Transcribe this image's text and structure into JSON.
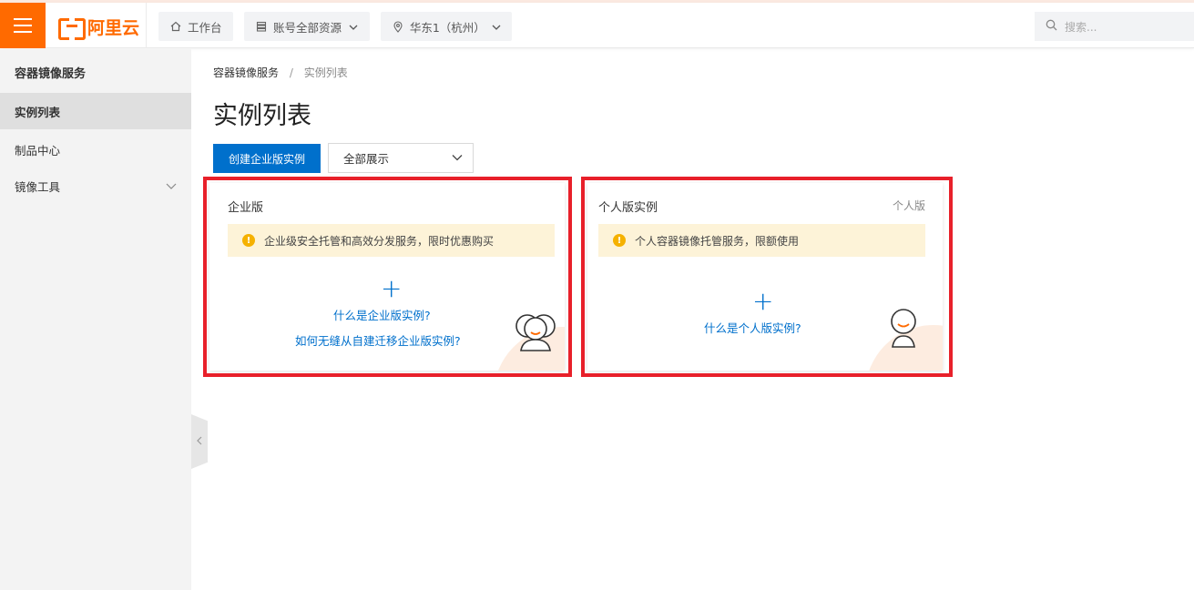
{
  "brand": {
    "name": "阿里云"
  },
  "topbar": {
    "workbench": "工作台",
    "resources": "账号全部资源",
    "region": "华东1（杭州）",
    "search_placeholder": "搜索..."
  },
  "sidebar": {
    "title": "容器镜像服务",
    "items": [
      {
        "label": "实例列表",
        "active": true
      },
      {
        "label": "制品中心"
      },
      {
        "label": "镜像工具"
      }
    ]
  },
  "breadcrumb": {
    "root": "容器镜像服务",
    "separator": "/",
    "current": "实例列表"
  },
  "page": {
    "title": "实例列表",
    "create_button": "创建企业版实例",
    "filter_value": "全部展示"
  },
  "cards": {
    "enterprise": {
      "title": "企业版",
      "notice": "企业级安全托管和高效分发服务，限时优惠购买",
      "link1": "什么是企业版实例?",
      "link2": "如何无缝从自建迁移企业版实例?"
    },
    "personal": {
      "title": "个人版实例",
      "tag": "个人版",
      "notice": "个人容器镜像托管服务，限额使用",
      "link1": "什么是个人版实例?"
    }
  },
  "colors": {
    "brand_orange": "#ff6a00",
    "primary_blue": "#0070cc",
    "highlight_red": "#e8202a",
    "notice_bg": "#fdf3d8"
  }
}
